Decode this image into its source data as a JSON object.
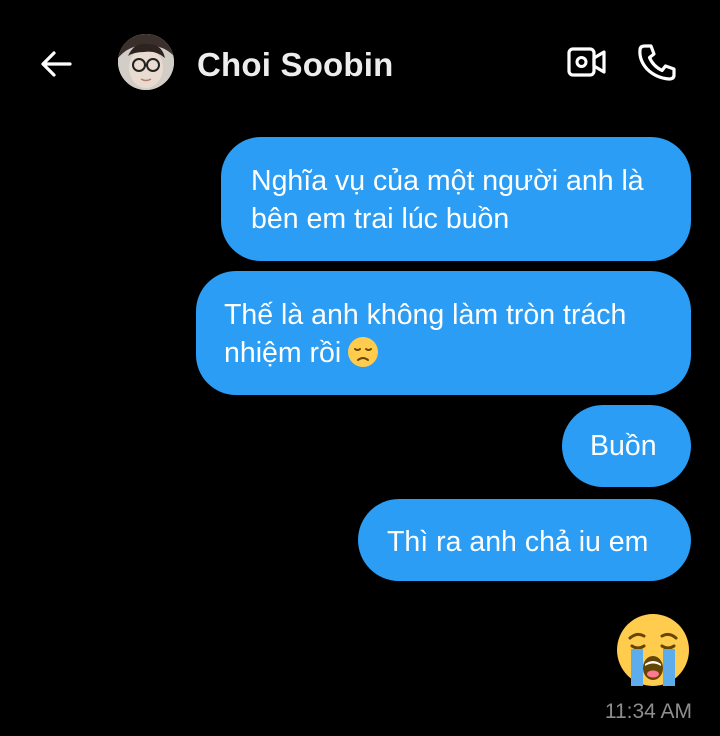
{
  "header": {
    "contact_name": "Choi Soobin",
    "icons": {
      "back": "arrow-left-icon",
      "video": "video-camera-icon",
      "call": "phone-icon"
    }
  },
  "messages": [
    {
      "text": "Nghĩa vụ của một người anh là bên em trai lúc buồn",
      "direction": "sent"
    },
    {
      "text": "Thế là anh không làm tròn trách nhiệm rồi",
      "emoji": "😞",
      "direction": "sent"
    },
    {
      "text": "Buồn",
      "direction": "sent"
    },
    {
      "text": "Thì ra anh chả iu em",
      "direction": "sent"
    },
    {
      "emoji": "😭",
      "direction": "sent"
    }
  ],
  "timestamp": "11:34 AM",
  "colors": {
    "background": "#000000",
    "bubble": "#2b9df4",
    "timestamp": "#8e8e8e"
  }
}
